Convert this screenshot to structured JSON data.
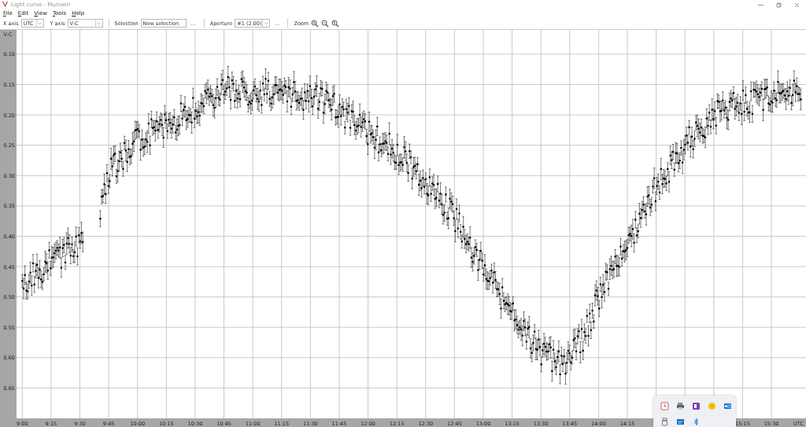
{
  "window": {
    "title": "Light curve - Muniwin"
  },
  "menu": [
    "File",
    "Edit",
    "View",
    "Tools",
    "Help"
  ],
  "toolbar": {
    "x_axis": {
      "label": "X axis",
      "value": "UTC"
    },
    "y_axis": {
      "label": "Y axis",
      "value": "V-C"
    },
    "selection": {
      "label": "Selection",
      "value": "New selection",
      "button": "..."
    },
    "aperture": {
      "label": "Aperture",
      "value": "#1 (2.00)",
      "button": "..."
    },
    "zoom": {
      "label": "Zoom"
    }
  },
  "chart": {
    "kind": "picture",
    "ylabel": "V-C",
    "xlabel": "UTC",
    "y_tick_labels": [
      "0.10",
      "0.15",
      "0.20",
      "0.25",
      "0.30",
      "0.35",
      "0.40",
      "0.45",
      "0.50",
      "0.55",
      "0.60",
      "0.65"
    ],
    "x_tick_labels": [
      "9:00",
      "9:15",
      "9:30",
      "9:45",
      "10:00",
      "10:15",
      "10:30",
      "10:45",
      "11:00",
      "11:15",
      "11:30",
      "11:45",
      "12:00",
      "12:15",
      "12:30",
      "12:45",
      "13:00",
      "13:15",
      "13:30",
      "13:45",
      "14:00",
      "14:15",
      "15:15",
      "15:30"
    ]
  }
}
